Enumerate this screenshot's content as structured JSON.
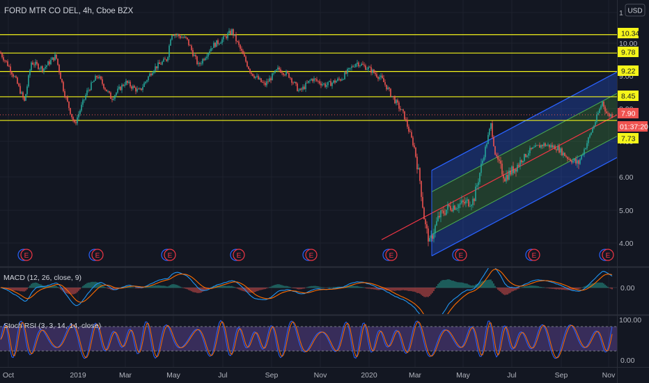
{
  "header": {
    "title": "FORD MTR CO DEL, 4h, Cboe BZX",
    "currency": "USD"
  },
  "colors": {
    "background": "#131722",
    "hline": "#f5f51a",
    "up": "#26a69a",
    "down": "#ef5350",
    "channel_outer": "#2962ff",
    "channel_inner": "#4caf50",
    "regression": "#f23645",
    "macd_line": "#2196f3",
    "macd_signal": "#ff6d00",
    "stoch_k": "#2962ff",
    "stoch_d": "#ff6d00",
    "stoch_band": "#7e57c2"
  },
  "price_axis": {
    "ticks": [
      "1",
      "10.00",
      "9.00",
      "8.00",
      "7.00",
      "6.00",
      "5.00",
      "4.00"
    ],
    "level_labels": [
      "10.34",
      "9.78",
      "9.22",
      "8.45",
      "7.73"
    ],
    "last_price": "7.90",
    "countdown": "01:37:20"
  },
  "time_axis": {
    "labels": [
      "Oct",
      "2019",
      "Mar",
      "May",
      "Jul",
      "Sep",
      "Nov",
      "2020",
      "Mar",
      "May",
      "Jul",
      "Sep",
      "Nov"
    ]
  },
  "earnings_marker": "E",
  "macd": {
    "label": "MACD (12, 26, close, 9)",
    "tick": "0.00"
  },
  "stoch": {
    "label": "Stoch RSI (3, 3, 14, 14, close)",
    "tick_top": "100.00",
    "tick_bottom": "0.00"
  },
  "chart_data": {
    "type": "candlestick",
    "title": "FORD MTR CO DEL, 4h, Cboe BZX",
    "x_labels": [
      "Oct",
      "2019",
      "Mar",
      "May",
      "Jul",
      "Sep",
      "Nov",
      "2020",
      "Mar",
      "May",
      "Jul",
      "Sep",
      "Nov"
    ],
    "y_ticks": [
      10.0,
      9.0,
      8.0,
      7.0,
      6.0,
      5.0,
      4.0
    ],
    "ylim": [
      3.5,
      10.9
    ],
    "horizontal_levels": [
      10.34,
      9.78,
      9.22,
      8.45,
      7.73
    ],
    "last_price": 7.9,
    "price_path": [
      [
        0,
        9.8
      ],
      [
        12,
        9.4
      ],
      [
        22,
        9.0
      ],
      [
        35,
        8.3
      ],
      [
        45,
        9.5
      ],
      [
        62,
        9.3
      ],
      [
        80,
        9.7
      ],
      [
        92,
        8.6
      ],
      [
        107,
        7.6
      ],
      [
        125,
        8.6
      ],
      [
        140,
        9.1
      ],
      [
        160,
        8.4
      ],
      [
        180,
        8.9
      ],
      [
        200,
        8.6
      ],
      [
        220,
        9.3
      ],
      [
        240,
        9.6
      ],
      [
        246,
        10.4
      ],
      [
        268,
        10.2
      ],
      [
        285,
        9.4
      ],
      [
        305,
        10.0
      ],
      [
        320,
        10.2
      ],
      [
        333,
        10.45
      ],
      [
        345,
        9.9
      ],
      [
        360,
        9.2
      ],
      [
        380,
        8.8
      ],
      [
        400,
        9.3
      ],
      [
        415,
        9.1
      ],
      [
        430,
        8.6
      ],
      [
        448,
        9.0
      ],
      [
        468,
        8.8
      ],
      [
        490,
        9.0
      ],
      [
        512,
        9.5
      ],
      [
        530,
        9.3
      ],
      [
        548,
        9.0
      ],
      [
        565,
        8.4
      ],
      [
        580,
        7.9
      ],
      [
        595,
        6.9
      ],
      [
        603,
        5.9
      ],
      [
        610,
        4.6
      ],
      [
        617,
        4.0
      ],
      [
        630,
        4.8
      ],
      [
        645,
        5.1
      ],
      [
        665,
        5.2
      ],
      [
        680,
        5.3
      ],
      [
        695,
        6.7
      ],
      [
        705,
        7.6
      ],
      [
        712,
        6.6
      ],
      [
        725,
        6.0
      ],
      [
        740,
        6.3
      ],
      [
        760,
        6.8
      ],
      [
        780,
        7.0
      ],
      [
        800,
        6.9
      ],
      [
        815,
        6.6
      ],
      [
        830,
        6.4
      ],
      [
        842,
        7.0
      ],
      [
        855,
        7.7
      ],
      [
        865,
        8.3
      ],
      [
        872,
        7.9
      ],
      [
        880,
        7.9
      ]
    ],
    "regression_channel": {
      "start": [
        548,
        4.1
      ],
      "end": [
        886,
        7.9
      ],
      "outer_offset": 1.3,
      "inner_offset": 0.65
    },
    "earnings_x": [
      38,
      140,
      244,
      343,
      447,
      562,
      662,
      767,
      873
    ]
  }
}
